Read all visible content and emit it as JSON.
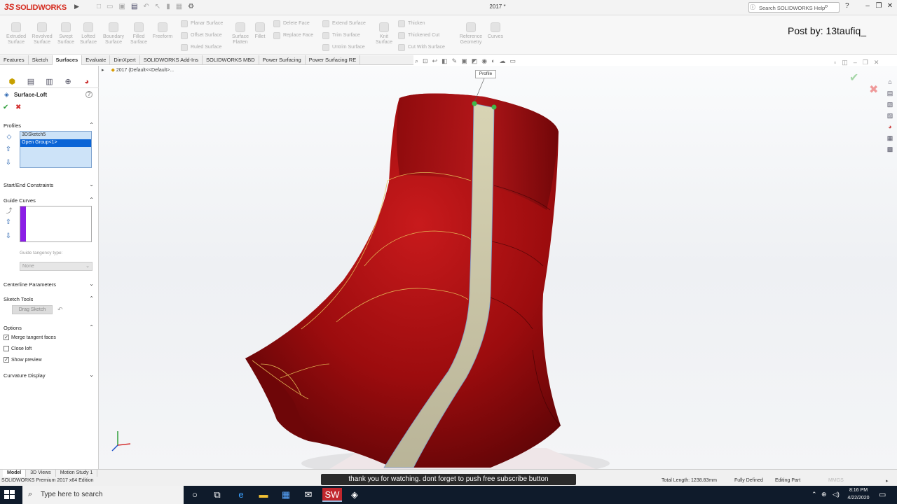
{
  "titlebar": {
    "logo_prefix": "3S",
    "logo_text": "SOLIDWORKS",
    "doc_title": "2017 *",
    "help_search_placeholder": "Search SOLIDWORKS Help",
    "help_label": "?"
  },
  "commands": {
    "big_tools": [
      {
        "label": "Extruded Surface"
      },
      {
        "label": "Revolved Surface"
      },
      {
        "label": "Swept Surface"
      },
      {
        "label": "Lofted Surface"
      },
      {
        "label": "Boundary Surface"
      },
      {
        "label": "Filled Surface"
      },
      {
        "label": "Freeform"
      }
    ],
    "col1": [
      "Planar Surface",
      "Offset Surface",
      "Ruled Surface"
    ],
    "surface_flatten": "Surface Flatten",
    "fillet": "Fillet",
    "col2": [
      "Delete Face",
      "Replace Face"
    ],
    "col3": [
      "Extend Surface",
      "Trim Surface",
      "Untrim Surface"
    ],
    "knit": "Knit Surface",
    "col4": [
      "Thicken",
      "Thickened Cut",
      "Cut With Surface"
    ],
    "reference_geometry": "Reference Geometry",
    "curves": "Curves"
  },
  "watermark": "Post by: 13taufiq_",
  "tabs": [
    "Features",
    "Sketch",
    "Surfaces",
    "Evaluate",
    "DimXpert",
    "SOLIDWORKS Add-Ins",
    "SOLIDWORKS MBD",
    "Power Surfacing",
    "Power Surfacing RE"
  ],
  "active_tab": "Surfaces",
  "pm": {
    "title": "Surface-Loft",
    "profiles_title": "Profiles",
    "profiles": [
      "3DSketch5",
      "Open Group<1>"
    ],
    "start_end_title": "Start/End Constraints",
    "guide_curves_title": "Guide Curves",
    "guide_tangency_label": "Guide tangency type:",
    "guide_tangency_value": "None",
    "centerline_title": "Centerline Parameters",
    "sketch_tools_title": "Sketch Tools",
    "drag_sketch": "Drag Sketch",
    "options_title": "Options",
    "options": [
      {
        "label": "Merge tangent faces",
        "checked": true
      },
      {
        "label": "Close loft",
        "checked": false
      },
      {
        "label": "Show preview",
        "checked": true
      }
    ],
    "curvature_title": "Curvature Display"
  },
  "viewport": {
    "tree_flyout": "2017  (Default<<Default>...",
    "tooltip": "Profile"
  },
  "model_tabs": [
    "Model",
    "3D Views",
    "Motion Study 1"
  ],
  "status": {
    "edition": "SOLIDWORKS Premium 2017 x64 Edition",
    "total_length": "Total Length: 1238.83mm",
    "defined": "Fully Defined",
    "editing": "Editing Part",
    "units": "MMGS"
  },
  "caption": "thank you for watching. dont forget to push free subscribe button",
  "taskbar": {
    "search_placeholder": "Type here to search",
    "time": "8:16 PM",
    "date": "4/22/2020"
  },
  "colors": {
    "model_red": "#9c0c0e",
    "highlight_strip": "#c8c4a0",
    "selection_blue": "#0a64d6",
    "taskbar": "#0f1b2b"
  }
}
